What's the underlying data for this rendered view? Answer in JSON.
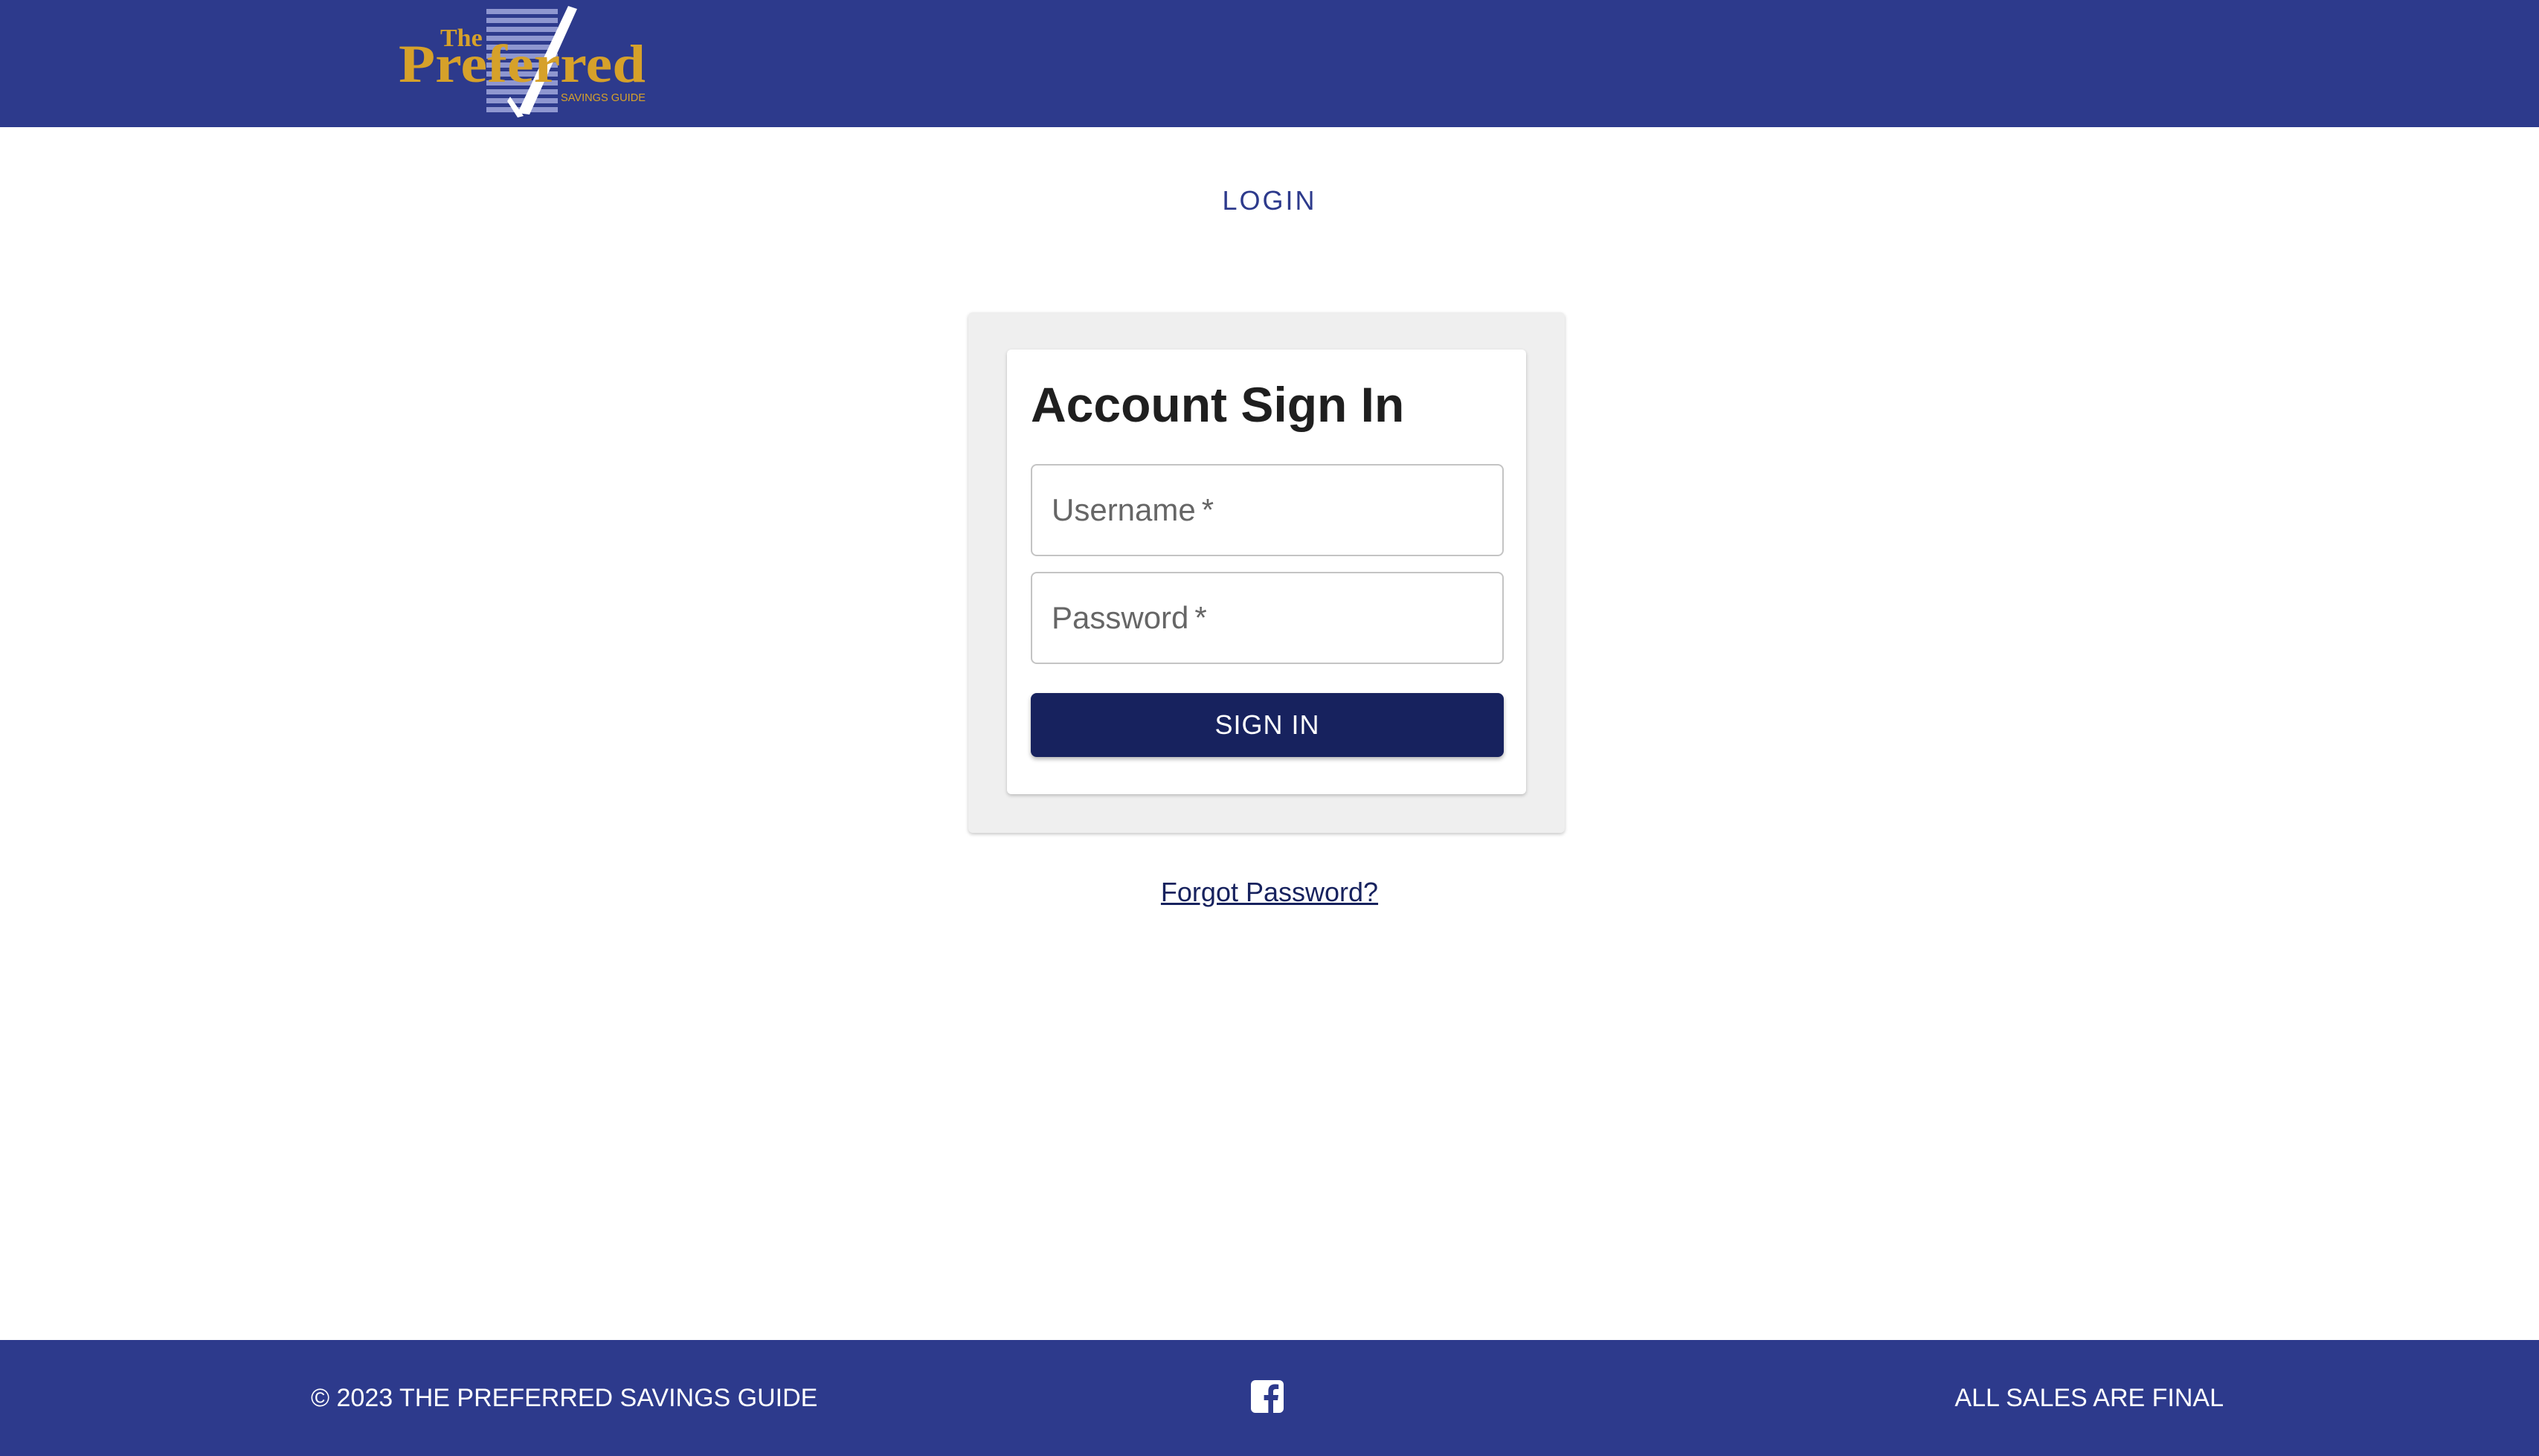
{
  "header": {
    "logo": {
      "text_the": "The",
      "text_main": "Preferred",
      "text_sub": "SAVINGS GUIDE",
      "gold": "#d6a12a"
    },
    "background": "#2d3a8c"
  },
  "page": {
    "title": "LOGIN"
  },
  "signin": {
    "heading": "Account Sign In",
    "username_label": "Username",
    "password_label": "Password",
    "required_marker": "*",
    "button_label": "SIGN IN",
    "button_color": "#17225e"
  },
  "forgot": {
    "label": "Forgot Password?"
  },
  "footer": {
    "copyright": "© 2023 THE PREFERRED SAVINGS GUIDE",
    "social_icon": "facebook-icon",
    "sales_note": "ALL SALES ARE FINAL",
    "background": "#2d3a8c"
  }
}
